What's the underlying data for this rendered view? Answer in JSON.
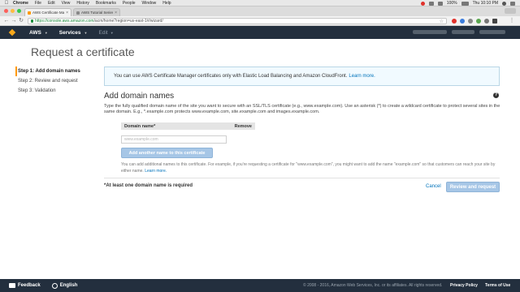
{
  "os_menu": {
    "app": "Chrome",
    "items": [
      "File",
      "Edit",
      "View",
      "History",
      "Bookmarks",
      "People",
      "Window",
      "Help"
    ],
    "battery": "100%",
    "clock": "Thu 10:10 PM"
  },
  "browser": {
    "tabs": [
      {
        "label": "AWS Certificate Manager",
        "close": "×"
      },
      {
        "label": "AWS Tutorial Series - Ba",
        "close": "×"
      }
    ],
    "url_host": "https://console.aws.amazon.com",
    "url_path": "/acm/home?region=us-east-1#/wizard/"
  },
  "aws_nav": {
    "brand": "AWS",
    "services": "Services",
    "edit": "Edit"
  },
  "page_title": "Request a certificate",
  "steps": [
    "Step 1: Add domain names",
    "Step 2: Review and request",
    "Step 3: Validation"
  ],
  "info": {
    "text": "You can use AWS Certificate Manager certificates only with Elastic Load Balancing and Amazon CloudFront.",
    "link": "Learn more."
  },
  "section": {
    "heading": "Add domain names",
    "description": "Type the fully qualified domain name of the site you want to secure with an SSL/TLS certificate (e.g., www.example.com). Use an asterisk (*) to create a wildcard certificate to protect several sites in the same domain. E.g., *.example.com protects www.example.com, site.example.com and images.example.com."
  },
  "domain_table": {
    "col_name": "Domain name*",
    "col_remove": "Remove",
    "placeholder": "www.example.com"
  },
  "add_button": "Add another name to this certificate",
  "hint": {
    "text": "You can add additional names to this certificate. For example, if you're requesting a certificate for \"www.example.com\", you might want to add the name \"example.com\" so that customers can reach your site by either name.",
    "link": "Learn more."
  },
  "required_note": "*At least one domain name is required",
  "actions": {
    "cancel": "Cancel",
    "review": "Review and request"
  },
  "footer": {
    "feedback": "Feedback",
    "language": "English",
    "copyright": "© 2008 - 2016, Amazon Web Services, Inc. or its affiliates. All rights reserved.",
    "privacy": "Privacy Policy",
    "terms": "Terms of Use"
  },
  "colors": {
    "aws_nav_bg": "#232f3e",
    "aws_orange": "#f7a81b",
    "link_blue": "#0073bb",
    "disabled_button": "#a6c6e6",
    "info_bg": "#f1faff"
  }
}
